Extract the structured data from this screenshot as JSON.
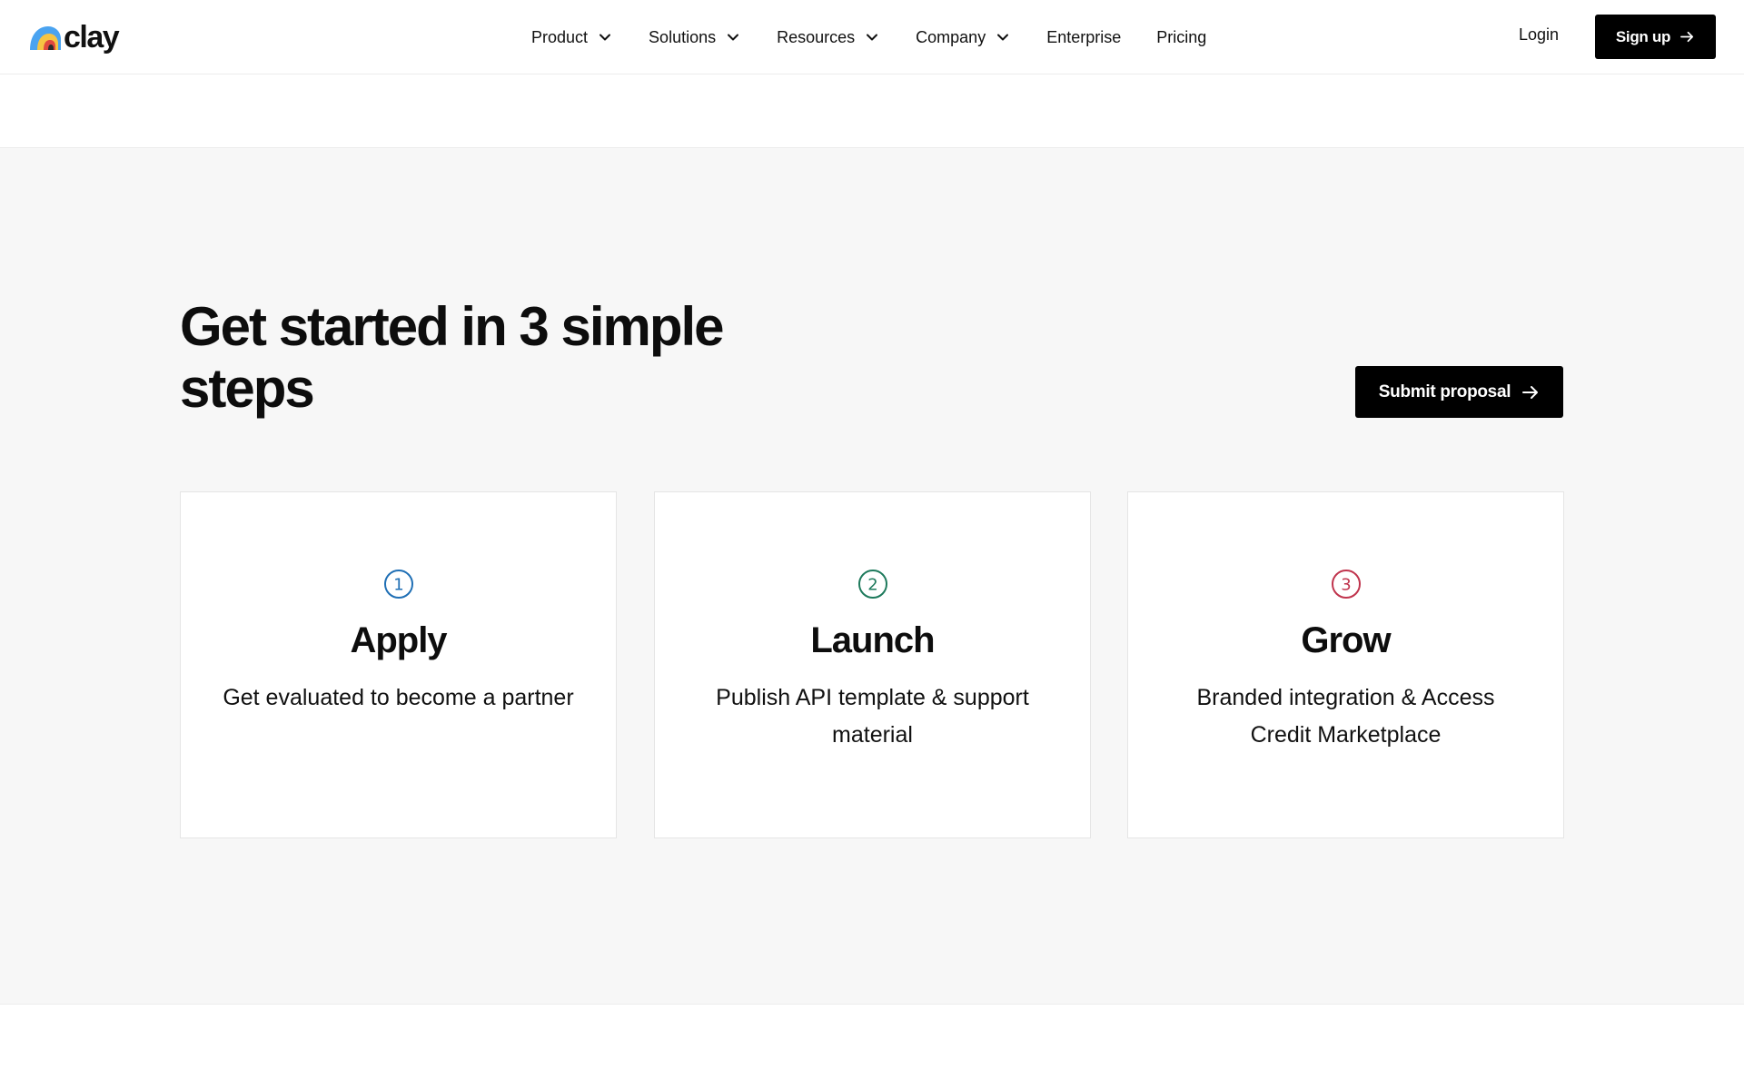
{
  "header": {
    "logo_text": "clay",
    "nav": [
      {
        "label": "Product",
        "has_dropdown": true
      },
      {
        "label": "Solutions",
        "has_dropdown": true
      },
      {
        "label": "Resources",
        "has_dropdown": true
      },
      {
        "label": "Company",
        "has_dropdown": true
      },
      {
        "label": "Enterprise",
        "has_dropdown": false
      },
      {
        "label": "Pricing",
        "has_dropdown": false
      }
    ],
    "login_label": "Login",
    "signup_label": "Sign up"
  },
  "section": {
    "heading": "Get started in 3 simple steps",
    "submit_label": "Submit proposal",
    "steps": [
      {
        "number": "1",
        "title": "Apply",
        "description": "Get evaluated to become a partner",
        "color": "#1f6fb5"
      },
      {
        "number": "2",
        "title": "Launch",
        "description": "Publish API template & support material",
        "color": "#1e7a5c"
      },
      {
        "number": "3",
        "title": "Grow",
        "description": "Branded integration & Access Credit Marketplace",
        "color": "#c0344d"
      }
    ]
  },
  "icons": {
    "logo": "clay-rainbow-logo-icon",
    "nav_dropdown": "chevron-down-icon",
    "button_arrow": "arrow-right-icon",
    "step": "circled-number-icon"
  },
  "colors": {
    "button_bg": "#000000",
    "section_bg": "#f7f7f7",
    "logo_blue": "#4aa3f0",
    "logo_yellow": "#f6c443",
    "logo_red": "#e0493f"
  }
}
